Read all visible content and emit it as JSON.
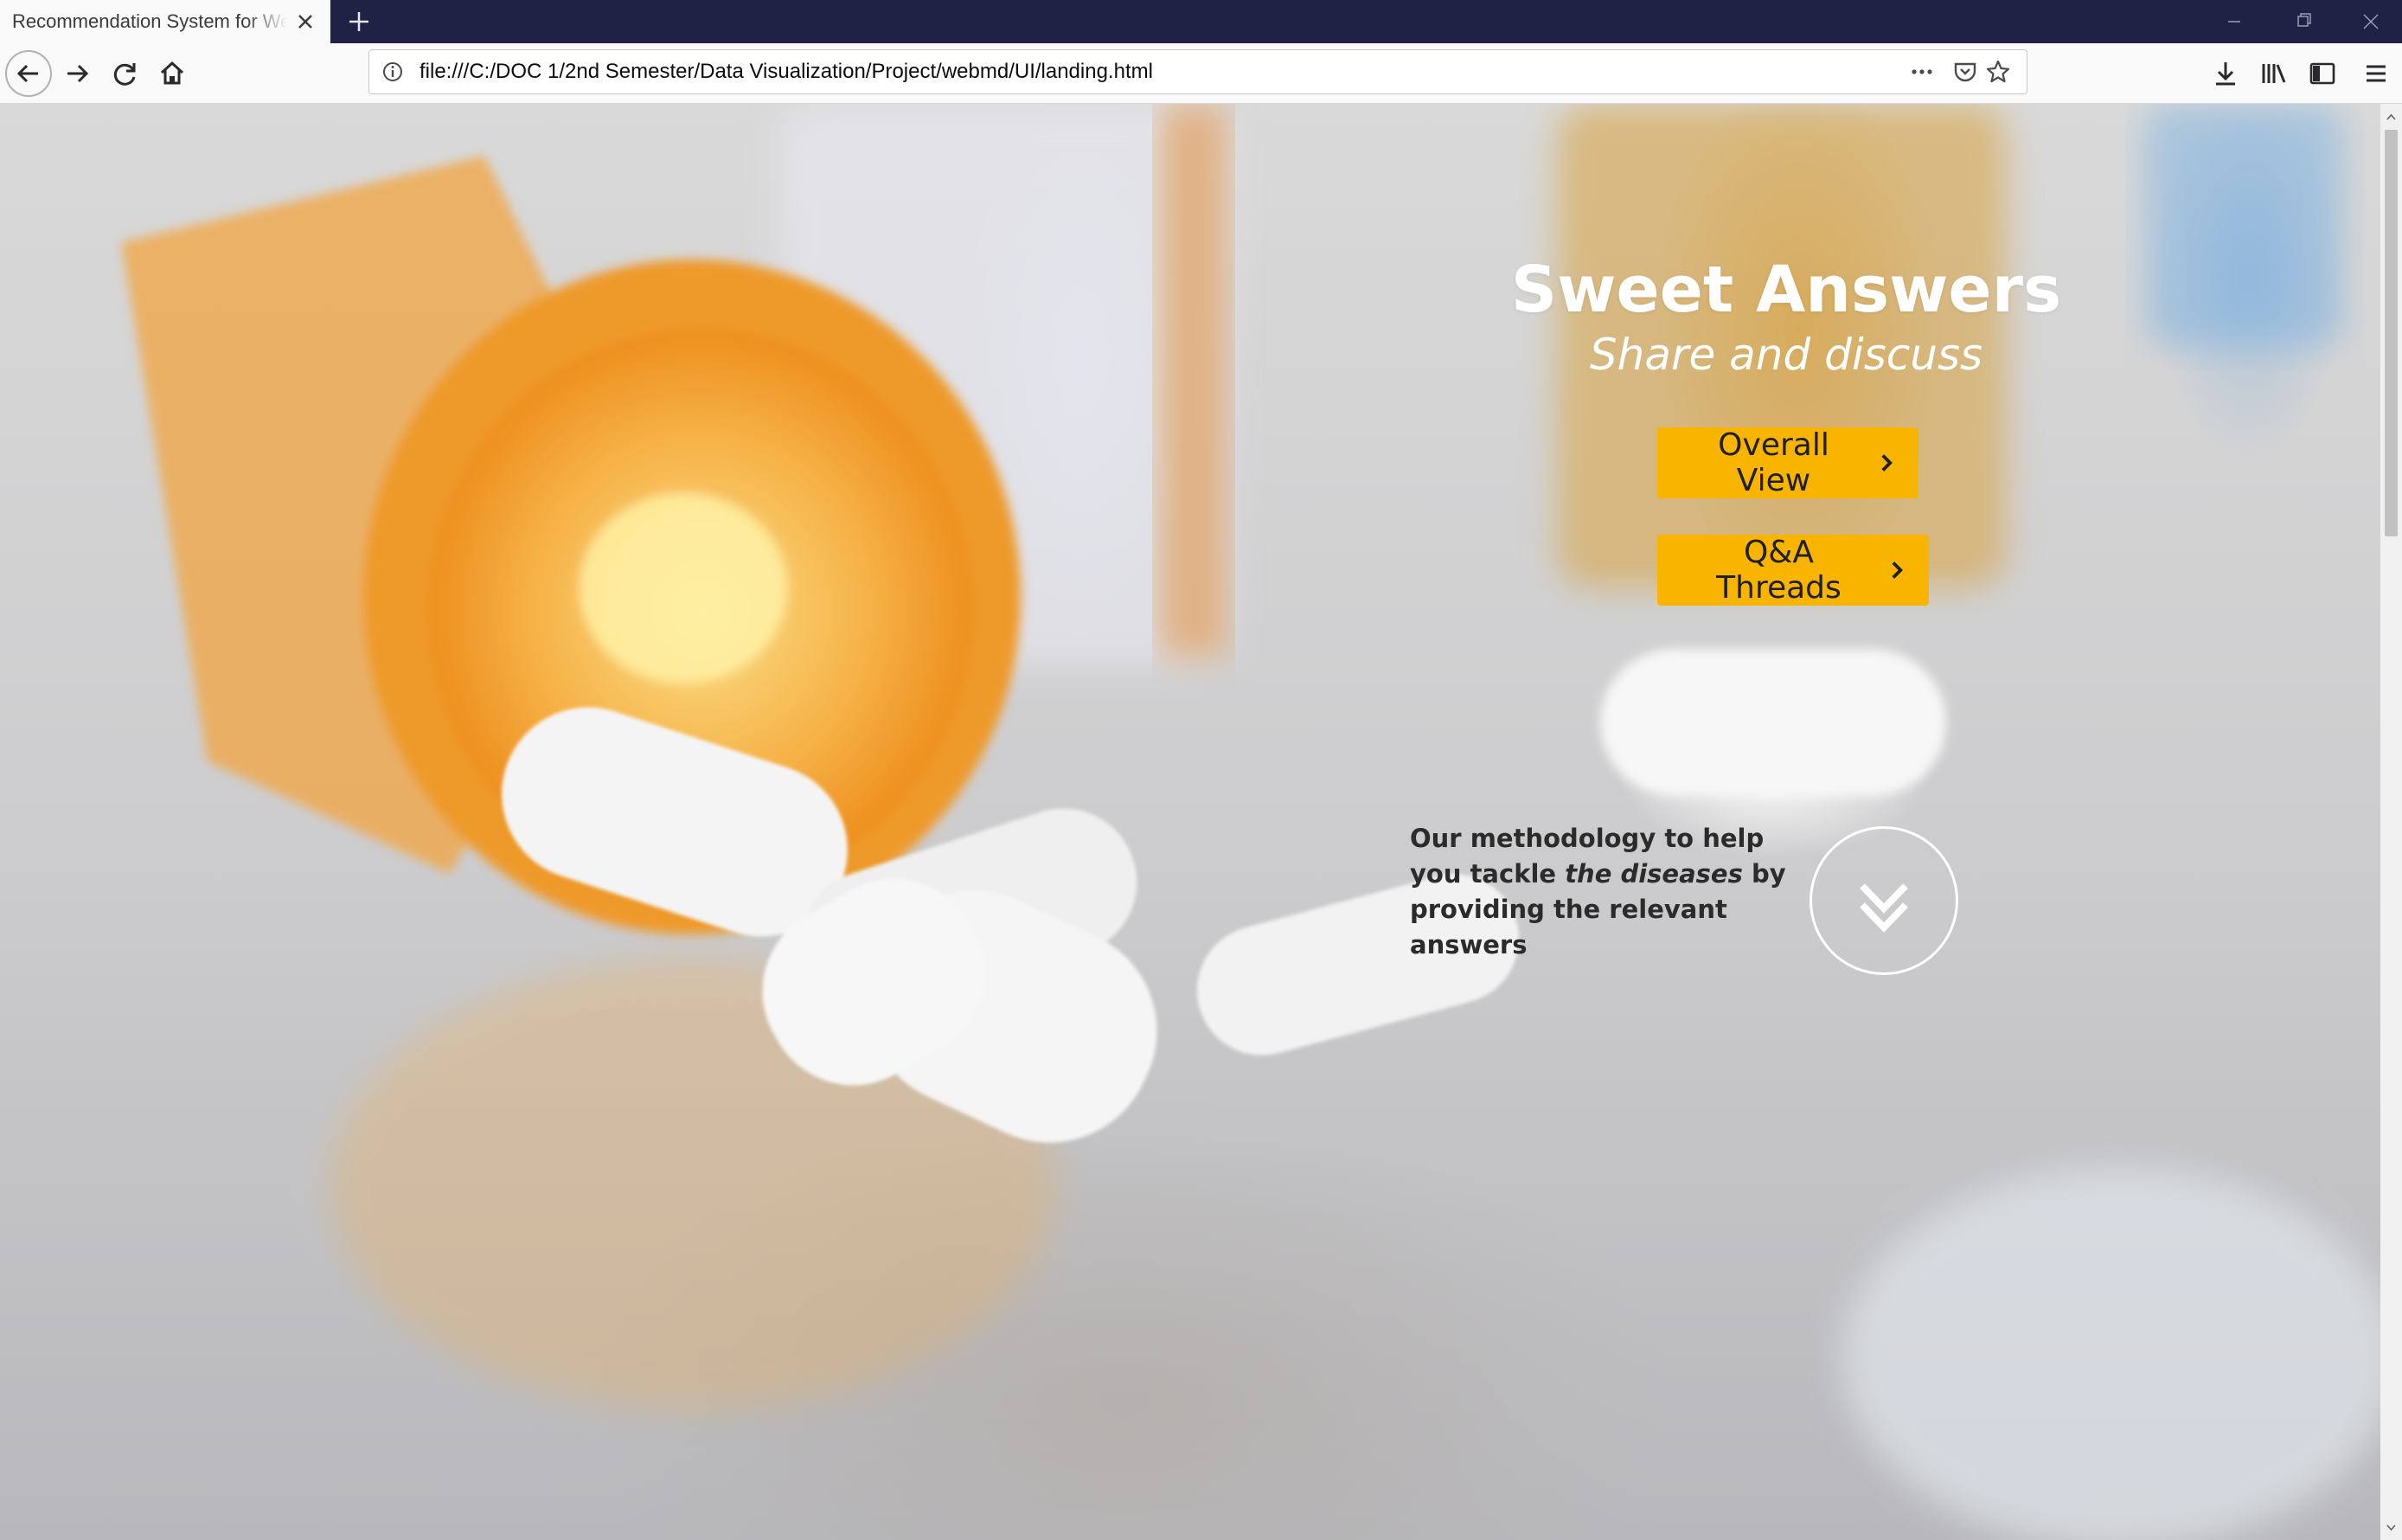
{
  "browser": {
    "tab_title": "Recommendation System for WebMD",
    "url": "file:///C:/DOC 1/2nd Semester/Data Visualization/Project/webmd/UI/landing.html"
  },
  "hero": {
    "title": "Sweet Answers",
    "subtitle": "Share and discuss",
    "buttons": {
      "overall_view": "Overall View",
      "qa_threads": "Q&A Threads"
    },
    "methodology": {
      "before": "Our methodology to help you tackle ",
      "emphasis": "the diseases",
      "after": " by providing the relevant answers"
    }
  },
  "colors": {
    "accent": "#f9b400",
    "tab_strip": "#1f2245"
  },
  "icons": [
    "close-icon",
    "plus-icon",
    "minimize-icon",
    "restore-icon",
    "back-arrow-icon",
    "forward-arrow-icon",
    "reload-icon",
    "home-icon",
    "info-icon",
    "more-icon",
    "pocket-icon",
    "star-icon",
    "download-icon",
    "library-icon",
    "sidebar-icon",
    "menu-icon",
    "chevron-right-icon",
    "double-chevron-down-icon"
  ]
}
